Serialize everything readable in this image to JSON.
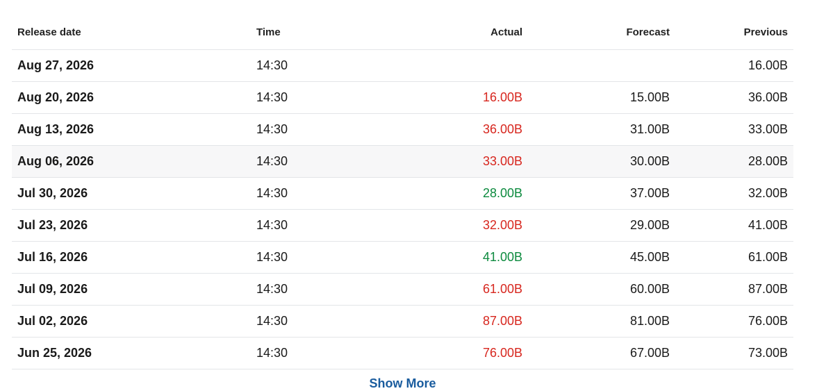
{
  "table": {
    "headers": {
      "release_date": "Release date",
      "time": "Time",
      "actual": "Actual",
      "forecast": "Forecast",
      "previous": "Previous"
    },
    "rows": [
      {
        "date": "Aug 27, 2026",
        "time": "14:30",
        "actual": "",
        "actual_status": "none",
        "forecast": "",
        "previous": "16.00B"
      },
      {
        "date": "Aug 20, 2026",
        "time": "14:30",
        "actual": "16.00B",
        "actual_status": "negative",
        "forecast": "15.00B",
        "previous": "36.00B"
      },
      {
        "date": "Aug 13, 2026",
        "time": "14:30",
        "actual": "36.00B",
        "actual_status": "negative",
        "forecast": "31.00B",
        "previous": "33.00B"
      },
      {
        "date": "Aug 06, 2026",
        "time": "14:30",
        "actual": "33.00B",
        "actual_status": "negative",
        "forecast": "30.00B",
        "previous": "28.00B"
      },
      {
        "date": "Jul 30, 2026",
        "time": "14:30",
        "actual": "28.00B",
        "actual_status": "positive",
        "forecast": "37.00B",
        "previous": "32.00B"
      },
      {
        "date": "Jul 23, 2026",
        "time": "14:30",
        "actual": "32.00B",
        "actual_status": "negative",
        "forecast": "29.00B",
        "previous": "41.00B"
      },
      {
        "date": "Jul 16, 2026",
        "time": "14:30",
        "actual": "41.00B",
        "actual_status": "positive",
        "forecast": "45.00B",
        "previous": "61.00B"
      },
      {
        "date": "Jul 09, 2026",
        "time": "14:30",
        "actual": "61.00B",
        "actual_status": "negative",
        "forecast": "60.00B",
        "previous": "87.00B"
      },
      {
        "date": "Jul 02, 2026",
        "time": "14:30",
        "actual": "87.00B",
        "actual_status": "negative",
        "forecast": "81.00B",
        "previous": "76.00B"
      },
      {
        "date": "Jun 25, 2026",
        "time": "14:30",
        "actual": "76.00B",
        "actual_status": "negative",
        "forecast": "67.00B",
        "previous": "73.00B"
      }
    ],
    "highlighted_row": 3
  },
  "show_more_label": "Show More",
  "colors": {
    "negative": "#d7261e",
    "positive": "#0c8a3e",
    "link": "#1a5c9e"
  }
}
